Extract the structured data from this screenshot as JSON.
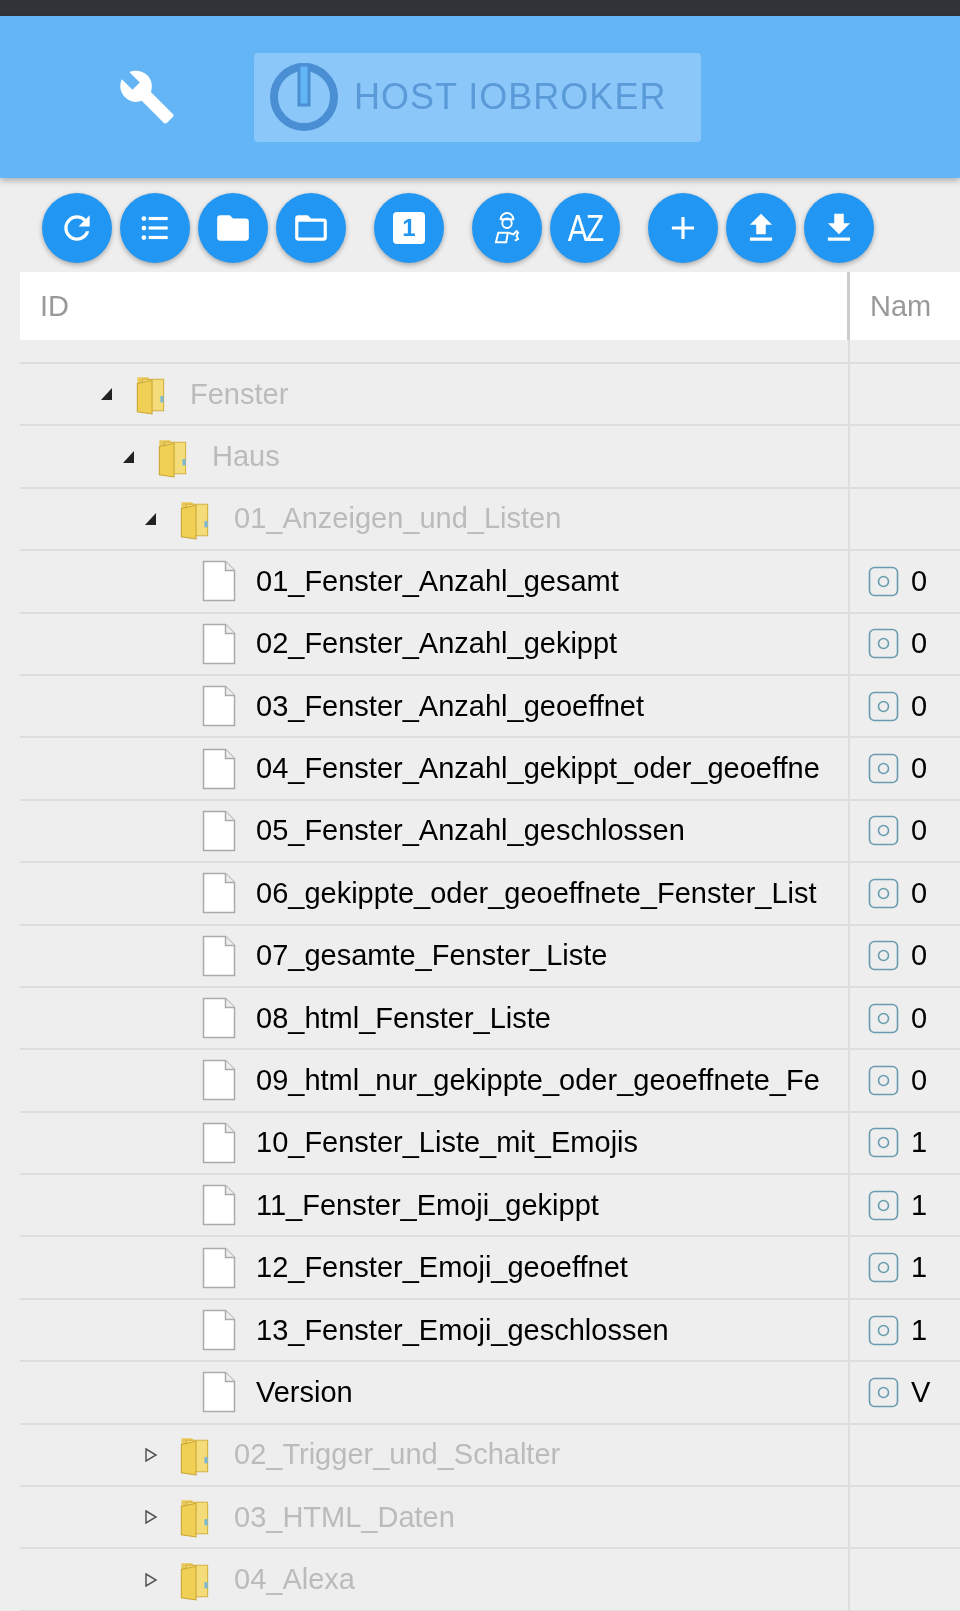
{
  "header": {
    "title": "HOST IOBROKER"
  },
  "toolbar": [
    [
      {
        "kind": "refresh"
      },
      {
        "kind": "list"
      },
      {
        "kind": "folder"
      },
      {
        "kind": "folder-outline"
      }
    ],
    [
      {
        "kind": "number",
        "label": "1"
      }
    ],
    [
      {
        "kind": "expert"
      },
      {
        "kind": "sort",
        "label": "AZ"
      }
    ],
    [
      {
        "kind": "add"
      },
      {
        "kind": "upload"
      },
      {
        "kind": "download"
      }
    ]
  ],
  "table": {
    "columns": [
      "ID",
      "Nam"
    ],
    "tree": [
      {
        "kind": "folder",
        "label": "Fenster",
        "expanded": true,
        "children": [
          {
            "kind": "folder",
            "label": "Haus",
            "expanded": true,
            "children": [
              {
                "kind": "folder",
                "label": "01_Anzeigen_und_Listen",
                "expanded": true,
                "children": [
                  {
                    "kind": "state",
                    "label": "01_Fenster_Anzahl_gesamt",
                    "name": "0"
                  },
                  {
                    "kind": "state",
                    "label": "02_Fenster_Anzahl_gekippt",
                    "name": "0"
                  },
                  {
                    "kind": "state",
                    "label": "03_Fenster_Anzahl_geoeffnet",
                    "name": "0"
                  },
                  {
                    "kind": "state",
                    "label": "04_Fenster_Anzahl_gekippt_oder_geoeffne",
                    "name": "0"
                  },
                  {
                    "kind": "state",
                    "label": "05_Fenster_Anzahl_geschlossen",
                    "name": "0"
                  },
                  {
                    "kind": "state",
                    "label": "06_gekippte_oder_geoeffnete_Fenster_List",
                    "name": "0"
                  },
                  {
                    "kind": "state",
                    "label": "07_gesamte_Fenster_Liste",
                    "name": "0"
                  },
                  {
                    "kind": "state",
                    "label": "08_html_Fenster_Liste",
                    "name": "0"
                  },
                  {
                    "kind": "state",
                    "label": "09_html_nur_gekippte_oder_geoeffnete_Fe",
                    "name": "0"
                  },
                  {
                    "kind": "state",
                    "label": "10_Fenster_Liste_mit_Emojis",
                    "name": "1"
                  },
                  {
                    "kind": "state",
                    "label": "11_Fenster_Emoji_gekippt",
                    "name": "1"
                  },
                  {
                    "kind": "state",
                    "label": "12_Fenster_Emoji_geoeffnet",
                    "name": "1"
                  },
                  {
                    "kind": "state",
                    "label": "13_Fenster_Emoji_geschlossen",
                    "name": "1"
                  },
                  {
                    "kind": "state",
                    "label": "Version",
                    "name": "V"
                  }
                ]
              },
              {
                "kind": "folder",
                "label": "02_Trigger_und_Schalter",
                "expanded": false
              },
              {
                "kind": "folder",
                "label": "03_HTML_Daten",
                "expanded": false
              },
              {
                "kind": "folder",
                "label": "04_Alexa",
                "expanded": false
              }
            ]
          }
        ]
      }
    ]
  }
}
